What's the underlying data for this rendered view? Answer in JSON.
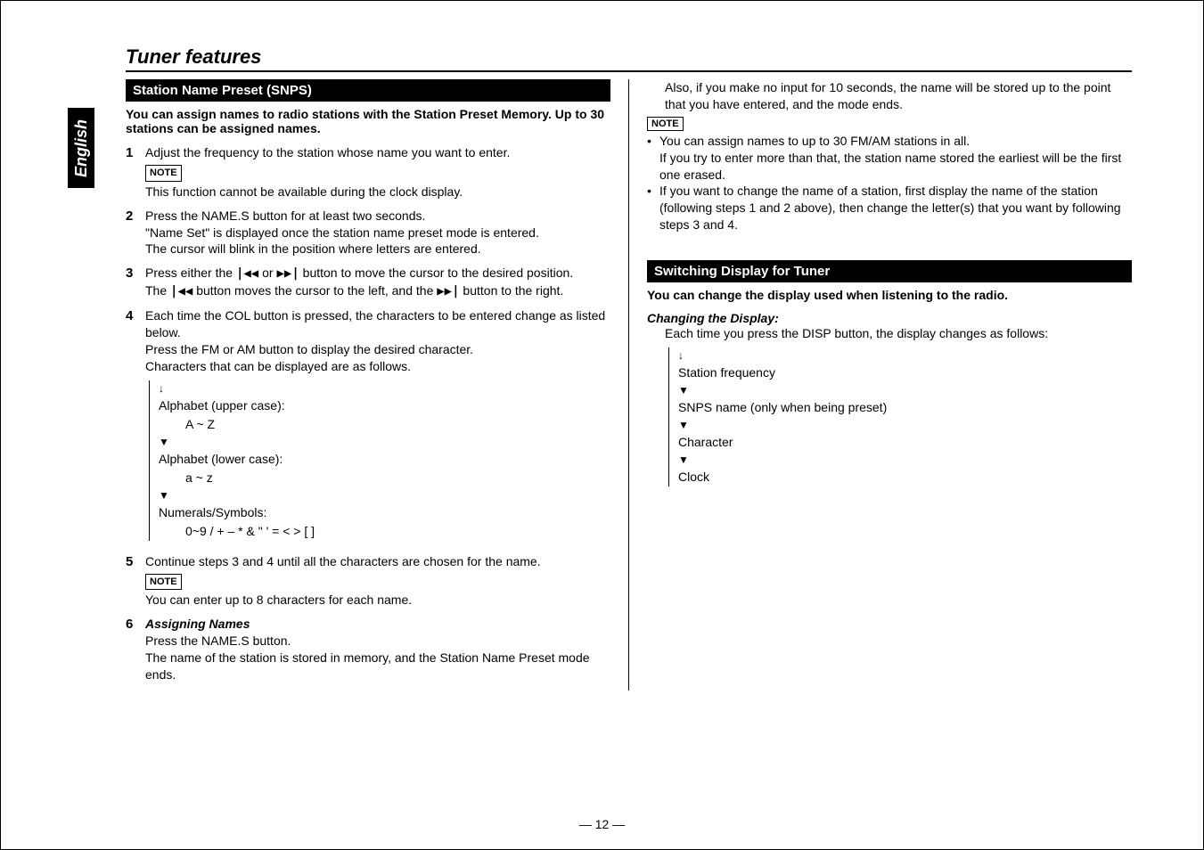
{
  "side_tab": "English",
  "section_title": "Tuner features",
  "left": {
    "header": "Station Name Preset (SNPS)",
    "intro": "You can assign names to radio stations with the Station Preset Memory. Up to 30 stations can be assigned names.",
    "step1": {
      "text": "Adjust the frequency to the station whose name you want to enter.",
      "note_label": "NOTE",
      "note_text": "This function cannot be available during the clock display."
    },
    "step2": {
      "l1": "Press the NAME.S button for at least two seconds.",
      "l2": "\"Name Set\" is displayed once the station name preset mode is entered.",
      "l3": "The cursor will blink in the position where letters are entered."
    },
    "step3": {
      "l1a": "Press either the ",
      "l1b": " or ",
      "l1c": " button to move the cursor to the desired position.",
      "l2a": "The ",
      "l2b": " button moves the cursor to the left, and the ",
      "l2c": " button to the right."
    },
    "step4": {
      "l1": "Each time the COL button is pressed, the characters to be entered change as listed below.",
      "l2": "Press the FM or AM button to display the desired character.",
      "l3": "Characters that can be displayed are as follows.",
      "cycle": {
        "c1": "Alphabet (upper case):",
        "c1v": "A ~ Z",
        "c2": "Alphabet (lower case):",
        "c2v": "a ~ z",
        "c3": "Numerals/Symbols:",
        "c3v": "0~9 / + – * & \"   ' = < > [ ]"
      }
    },
    "step5": {
      "text": "Continue steps 3 and 4 until all the characters are chosen for the name.",
      "note_label": "NOTE",
      "note_text": "You can enter up to 8 characters for each name."
    },
    "step6": {
      "title": "Assigning Names",
      "l1": "Press the NAME.S button.",
      "l2": "The name of the station is stored in memory, and the Station Name Preset mode ends."
    }
  },
  "right": {
    "cont_text": "Also, if you make no input for 10 seconds, the name will be stored up to the point that you have entered, and the mode ends.",
    "note_label": "NOTE",
    "bullet1a": "You can assign names to up to 30 FM/AM stations in all.",
    "bullet1b": "If you try to enter more than that, the station name stored the earliest will be the first one erased.",
    "bullet2": "If you want to change the name of a station, first display the name of the station (following steps 1 and 2 above), then change the letter(s) that you want by following steps 3 and 4.",
    "header2": "Switching Display for Tuner",
    "intro2": "You can change the display used when listening to the radio.",
    "subtitle2": "Changing the Display:",
    "desc2": "Each time you press the DISP button, the display changes as follows:",
    "cycle2": {
      "c1": "Station frequency",
      "c2": "SNPS name (only when being preset)",
      "c3": "Character",
      "c4": "Clock"
    }
  },
  "page_number": "— 12 —",
  "icons": {
    "prev": "|◀◀",
    "next": "▶▶|"
  }
}
